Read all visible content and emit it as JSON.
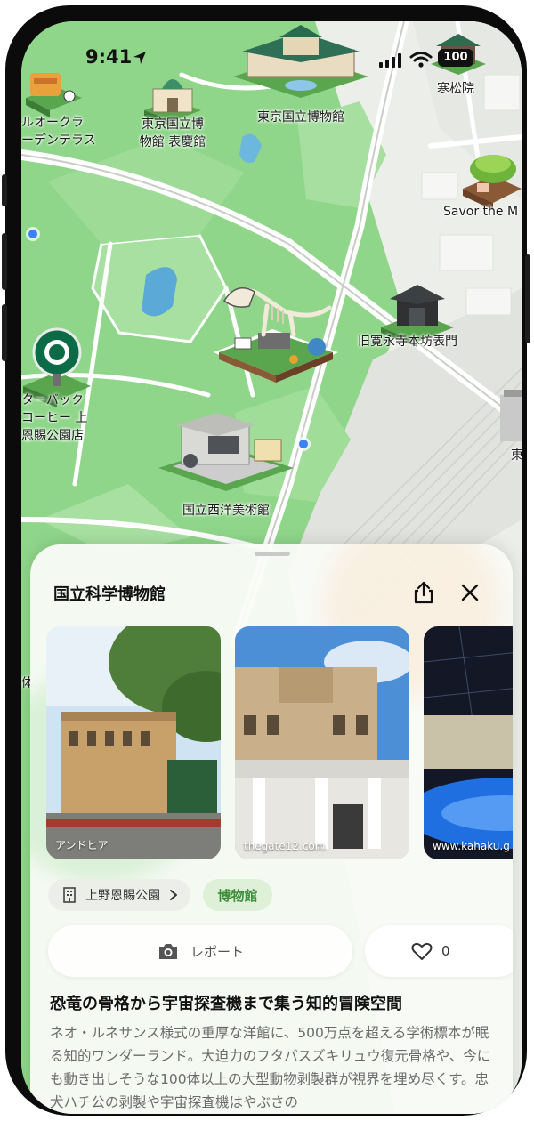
{
  "status_bar": {
    "time": "9:41",
    "battery": "100"
  },
  "map": {
    "labels": {
      "hotel": "ルオークラ\nーデンテラス",
      "hyokeikan": "東京国立博\n物館 表慶館",
      "national_museum": "東京国立博物館",
      "kanshoin": "寒松院",
      "savor": "Savor the M",
      "kaneiji_gate": "旧寛永寺本坊表門",
      "starbucks": "ターバック\nコーヒー 上\n恩賜公園店",
      "western_art": "国立西洋美術館",
      "edge_char": "東",
      "edge_char2": "体"
    }
  },
  "sheet": {
    "title": "国立科学博物館",
    "photos": [
      {
        "credit": "アンドヒア"
      },
      {
        "credit": "thegate12.com"
      },
      {
        "credit": "www.kahaku.g"
      }
    ],
    "park_chip": "上野恩賜公園",
    "category_chip": "博物館",
    "report_label": "レポート",
    "like_count": "0",
    "headline": "恐竜の骨格から宇宙探査機まで集う知的冒険空間",
    "description": "ネオ・ルネサンス様式の重厚な洋館に、500万点を超える学術標本が眠る知的ワンダーランド。大迫力のフタバスズキリュウ復元骨格や、今にも動き出しそうな100体以上の大型動物剥製群が視界を埋め尽くす。忠犬ハチ公の剥製や宇宙探査機はやぶさの"
  }
}
